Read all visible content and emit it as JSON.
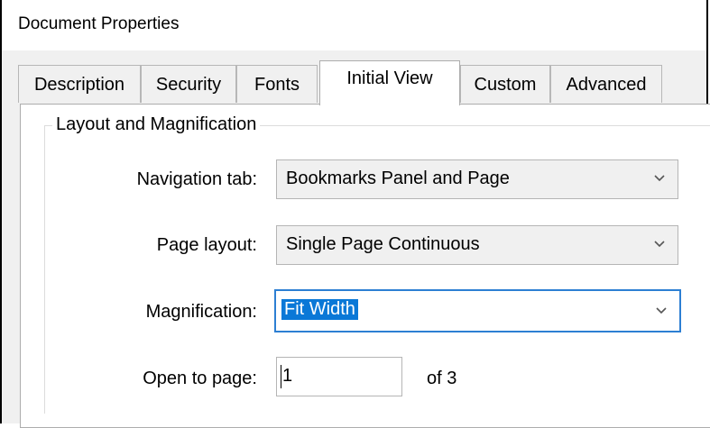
{
  "window": {
    "title": "Document Properties"
  },
  "tabs": [
    {
      "label": "Description"
    },
    {
      "label": "Security"
    },
    {
      "label": "Fonts"
    },
    {
      "label": "Initial View"
    },
    {
      "label": "Custom"
    },
    {
      "label": "Advanced"
    }
  ],
  "active_tab": "Initial View",
  "group": {
    "title": "Layout and Magnification"
  },
  "fields": {
    "navigation_tab": {
      "label": "Navigation tab:",
      "value": "Bookmarks Panel and Page"
    },
    "page_layout": {
      "label": "Page layout:",
      "value": "Single Page Continuous"
    },
    "magnification": {
      "label": "Magnification:",
      "value": "Fit Width"
    },
    "open_to_page": {
      "label": "Open to page:",
      "value": "1",
      "of_text": "of 3"
    }
  },
  "colors": {
    "accent": "#0a78d7",
    "focus_border": "#2d7fd3"
  }
}
